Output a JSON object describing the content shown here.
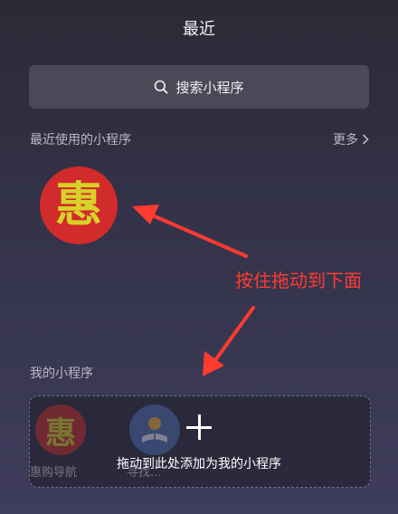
{
  "header": {
    "title": "最近"
  },
  "search": {
    "label": "搜索小程序",
    "icon": "search-icon"
  },
  "recent": {
    "title": "最近使用的小程序",
    "more_label": "更多",
    "apps": [
      {
        "glyph": "惠",
        "color": "#d22b2b",
        "glyph_color": "#d7d229"
      }
    ]
  },
  "annotation": {
    "hint": "按住拖动到下面",
    "color": "#ff3b30"
  },
  "mine": {
    "title": "我的小程序",
    "apps": [
      {
        "glyph": "惠",
        "label": "惠购导航"
      },
      {
        "label": "寻找..."
      }
    ],
    "drop_text": "拖动到此处添加为我的小程序"
  }
}
